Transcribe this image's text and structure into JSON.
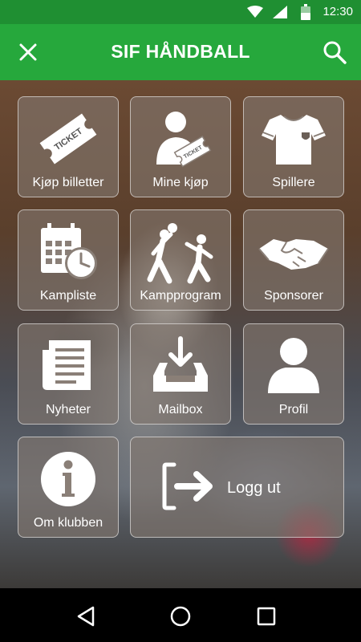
{
  "status_bar": {
    "time": "12:30"
  },
  "app_bar": {
    "title": "SIF HÅNDBALL"
  },
  "menu": {
    "buy_tickets": "Kjøp billetter",
    "my_purchases": "Mine kjøp",
    "players": "Spillere",
    "match_list": "Kampliste",
    "match_program": "Kampprogram",
    "sponsors": "Sponsorer",
    "news": "Nyheter",
    "mailbox": "Mailbox",
    "profile": "Profil",
    "about_club": "Om klubben",
    "logout": "Logg ut"
  },
  "icon_text": {
    "ticket": "TICKET"
  },
  "colors": {
    "status_bar": "#1f8f32",
    "app_bar": "#26a83c",
    "nav_bar": "#000000"
  }
}
